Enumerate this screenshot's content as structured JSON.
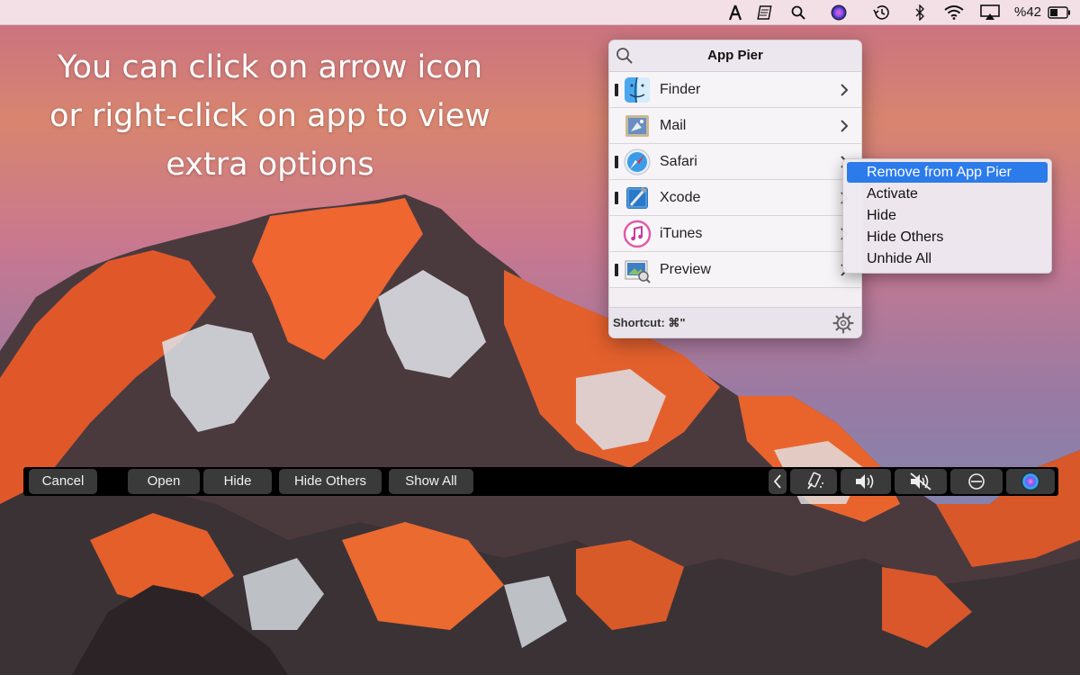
{
  "caption": {
    "line1": "You can click on arrow icon",
    "line2": "or right-click on app to view",
    "line3": "extra options"
  },
  "menubar": {
    "icons": [
      "app-pier-icon",
      "notes-icon",
      "spotlight-icon",
      "siri-icon",
      "time-machine-icon",
      "bluetooth-icon",
      "wifi-icon",
      "airplay-icon",
      "battery-icon"
    ],
    "battery_text": "%42"
  },
  "popover": {
    "title": "App Pier",
    "apps": [
      {
        "name": "Finder",
        "running": true,
        "icon": "finder-icon"
      },
      {
        "name": "Mail",
        "running": false,
        "icon": "mail-icon"
      },
      {
        "name": "Safari",
        "running": true,
        "icon": "safari-icon"
      },
      {
        "name": "Xcode",
        "running": true,
        "icon": "xcode-icon"
      },
      {
        "name": "iTunes",
        "running": false,
        "icon": "itunes-icon"
      },
      {
        "name": "Preview",
        "running": true,
        "icon": "preview-icon"
      }
    ],
    "shortcut": "Shortcut: ⌘\""
  },
  "context_menu": {
    "items": [
      {
        "label": "Remove from App Pier",
        "selected": true
      },
      {
        "label": "Activate",
        "selected": false
      },
      {
        "label": "Hide",
        "selected": false
      },
      {
        "label": "Hide Others",
        "selected": false
      },
      {
        "label": "Unhide All",
        "selected": false
      }
    ]
  },
  "touchbar": {
    "buttons": [
      "Cancel",
      "Open",
      "Hide",
      "Hide Others",
      "Show All"
    ],
    "controls": [
      "collapse-arrow-icon",
      "brightness-icon",
      "volume-up-icon",
      "mute-icon",
      "do-not-disturb-icon",
      "siri-icon"
    ]
  },
  "colors": {
    "selection": "#2c7bea",
    "touchbar_bg": "#000000",
    "touchbar_button": "#3a3a3a"
  }
}
